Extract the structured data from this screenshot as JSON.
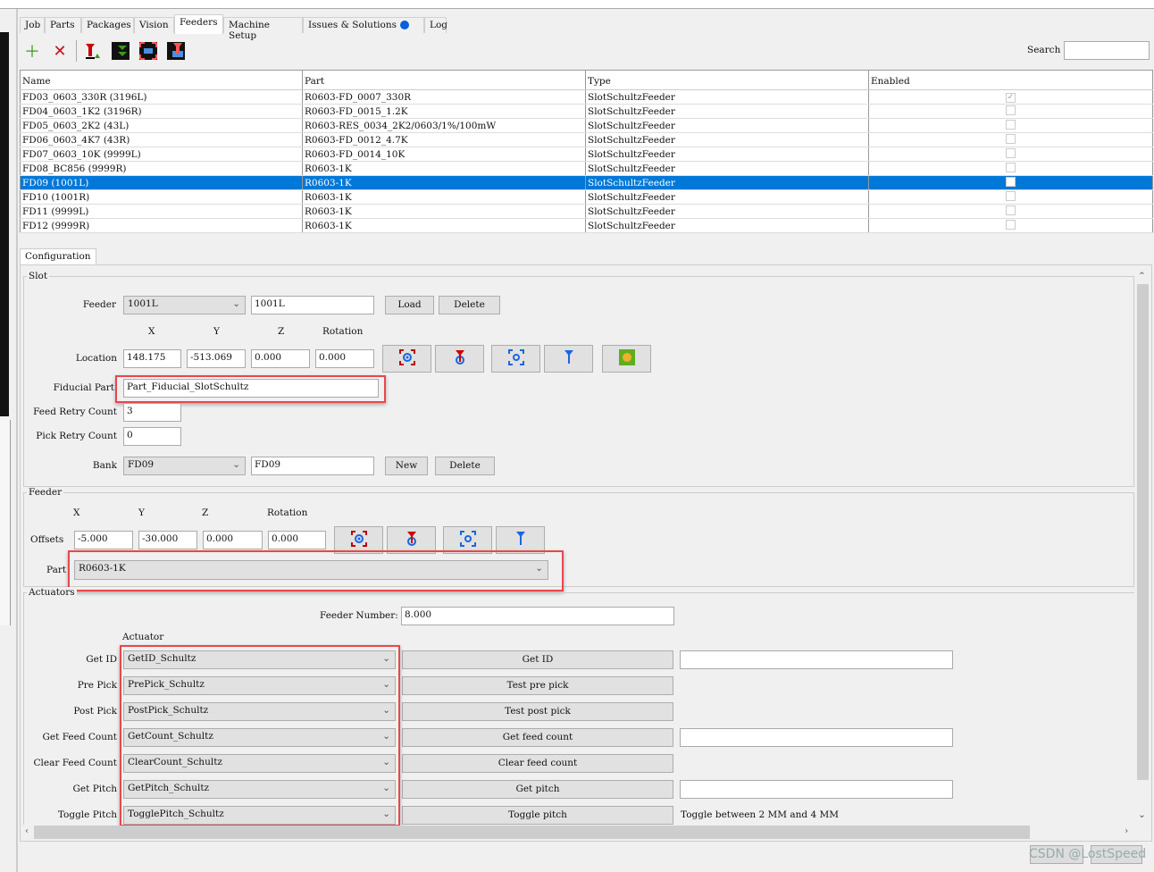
{
  "tabs": [
    {
      "label": "Job"
    },
    {
      "label": "Parts"
    },
    {
      "label": "Packages"
    },
    {
      "label": "Vision"
    },
    {
      "label": "Feeders",
      "active": true
    },
    {
      "label": "Machine Setup"
    },
    {
      "label": "Issues & Solutions"
    },
    {
      "label": "Log"
    }
  ],
  "toolbar": {
    "icons": [
      "add-icon",
      "delete-icon",
      "feed-icon",
      "pick-icon",
      "camera-move-icon",
      "nozzle-move-icon"
    ],
    "search_label": "Search",
    "search_value": ""
  },
  "table": {
    "columns": [
      "Name",
      "Part",
      "Type",
      "Enabled"
    ],
    "rows": [
      {
        "name": "FD03_0603_330R (3196L)",
        "part": "R0603-FD_0007_330R",
        "type": "SlotSchultzFeeder",
        "enabled": true
      },
      {
        "name": "FD04_0603_1K2 (3196R)",
        "part": "R0603-FD_0015_1.2K",
        "type": "SlotSchultzFeeder",
        "enabled": false
      },
      {
        "name": "FD05_0603_2K2 (43L)",
        "part": "R0603-RES_0034_2K2/0603/1%/100mW",
        "type": "SlotSchultzFeeder",
        "enabled": false
      },
      {
        "name": "FD06_0603_4K7 (43R)",
        "part": "R0603-FD_0012_4.7K",
        "type": "SlotSchultzFeeder",
        "enabled": false
      },
      {
        "name": "FD07_0603_10K (9999L)",
        "part": "R0603-FD_0014_10K",
        "type": "SlotSchultzFeeder",
        "enabled": false
      },
      {
        "name": "FD08_BC856 (9999R)",
        "part": "R0603-1K",
        "type": "SlotSchultzFeeder",
        "enabled": false
      },
      {
        "name": "FD09 (1001L)",
        "part": "R0603-1K",
        "type": "SlotSchultzFeeder",
        "enabled": false,
        "selected": true
      },
      {
        "name": "FD10 (1001R)",
        "part": "R0603-1K",
        "type": "SlotSchultzFeeder",
        "enabled": false
      },
      {
        "name": "FD11 (9999L)",
        "part": "R0603-1K",
        "type": "SlotSchultzFeeder",
        "enabled": false
      },
      {
        "name": "FD12 (9999R)",
        "part": "R0603-1K",
        "type": "SlotSchultzFeeder",
        "enabled": false
      }
    ]
  },
  "config_tab": "Configuration",
  "slot": {
    "title": "Slot",
    "feeder_label": "Feeder",
    "feeder_select": "1001L",
    "feeder_name": "1001L",
    "load": "Load",
    "delete": "Delete",
    "col_x": "X",
    "col_y": "Y",
    "col_z": "Z",
    "col_rot": "Rotation",
    "location_label": "Location",
    "x": "148.175",
    "y": "-513.069",
    "z": "0.000",
    "rot": "0.000",
    "fiducial_label": "Fiducial Part",
    "fiducial": "Part_Fiducial_SlotSchultz",
    "feed_retry_label": "Feed Retry Count",
    "feed_retry": "3",
    "pick_retry_label": "Pick Retry Count",
    "pick_retry": "0",
    "bank_label": "Bank",
    "bank_select": "FD09",
    "bank_name": "FD09",
    "new": "New",
    "bank_delete": "Delete"
  },
  "feeder": {
    "title": "Feeder",
    "col_x": "X",
    "col_y": "Y",
    "col_z": "Z",
    "col_rot": "Rotation",
    "offsets_label": "Offsets",
    "x": "-5.000",
    "y": "-30.000",
    "z": "0.000",
    "rot": "0.000",
    "part_label": "Part",
    "part": "R0603-1K"
  },
  "actuators": {
    "title": "Actuators",
    "feeder_number_label": "Feeder Number:",
    "feeder_number": "8.000",
    "actuator_header": "Actuator",
    "rows": [
      {
        "label": "Get ID",
        "actuator": "GetID_Schultz",
        "button": "Get ID",
        "has_field": true,
        "field": ""
      },
      {
        "label": "Pre Pick",
        "actuator": "PrePick_Schultz",
        "button": "Test pre pick",
        "has_field": false
      },
      {
        "label": "Post Pick",
        "actuator": "PostPick_Schultz",
        "button": "Test post pick",
        "has_field": false
      },
      {
        "label": "Get Feed Count",
        "actuator": "GetCount_Schultz",
        "button": "Get feed count",
        "has_field": true,
        "field": ""
      },
      {
        "label": "Clear Feed Count",
        "actuator": "ClearCount_Schultz",
        "button": "Clear feed count",
        "has_field": false
      },
      {
        "label": "Get Pitch",
        "actuator": "GetPitch_Schultz",
        "button": "Get pitch",
        "has_field": true,
        "field": ""
      },
      {
        "label": "Toggle Pitch",
        "actuator": "TogglePitch_Schultz",
        "button": "Toggle pitch",
        "has_field": false,
        "note": "Toggle between 2 MM and 4 MM"
      }
    ]
  },
  "watermark": "CSDN @LostSpeed",
  "colors": {
    "selection": "#0078d7",
    "highlight_box": "#e8474b",
    "issues_dot": "#0b5fd8"
  }
}
